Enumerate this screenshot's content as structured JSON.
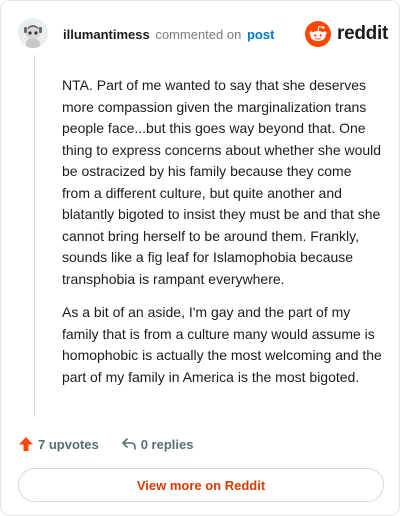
{
  "header": {
    "username": "illumantimess",
    "action": "commented on",
    "post_link": "post",
    "brand": "reddit"
  },
  "comment": {
    "paragraphs": [
      "NTA. Part of me wanted to say that she deserves more compassion given the marginalization trans people face...but this goes way beyond that. One thing to express concerns about whether she would be ostracized by his family because they come from a different culture, but quite another and blatantly bigoted to insist they must be and that she cannot bring herself to be around them. Frankly, sounds like a fig leaf for Islamophobia because transphobia is rampant everywhere.",
      "As a bit of an aside, I'm gay and the part of my family that is from a culture many would assume is homophobic is actually the most welcoming and the part of my family in America is the most bigoted."
    ]
  },
  "actions": {
    "upvotes": "7 upvotes",
    "replies": "0 replies"
  },
  "footer": {
    "view_more": "View more on Reddit"
  },
  "icons": {
    "avatar": "snoo-avatar-icon",
    "brand_logo": "reddit-logo-icon",
    "upvote": "upvote-arrow-icon",
    "reply": "reply-arrow-icon"
  },
  "colors": {
    "brand_orange": "#ff4500",
    "link_blue": "#0079d3",
    "view_more_text": "#d93a00"
  }
}
